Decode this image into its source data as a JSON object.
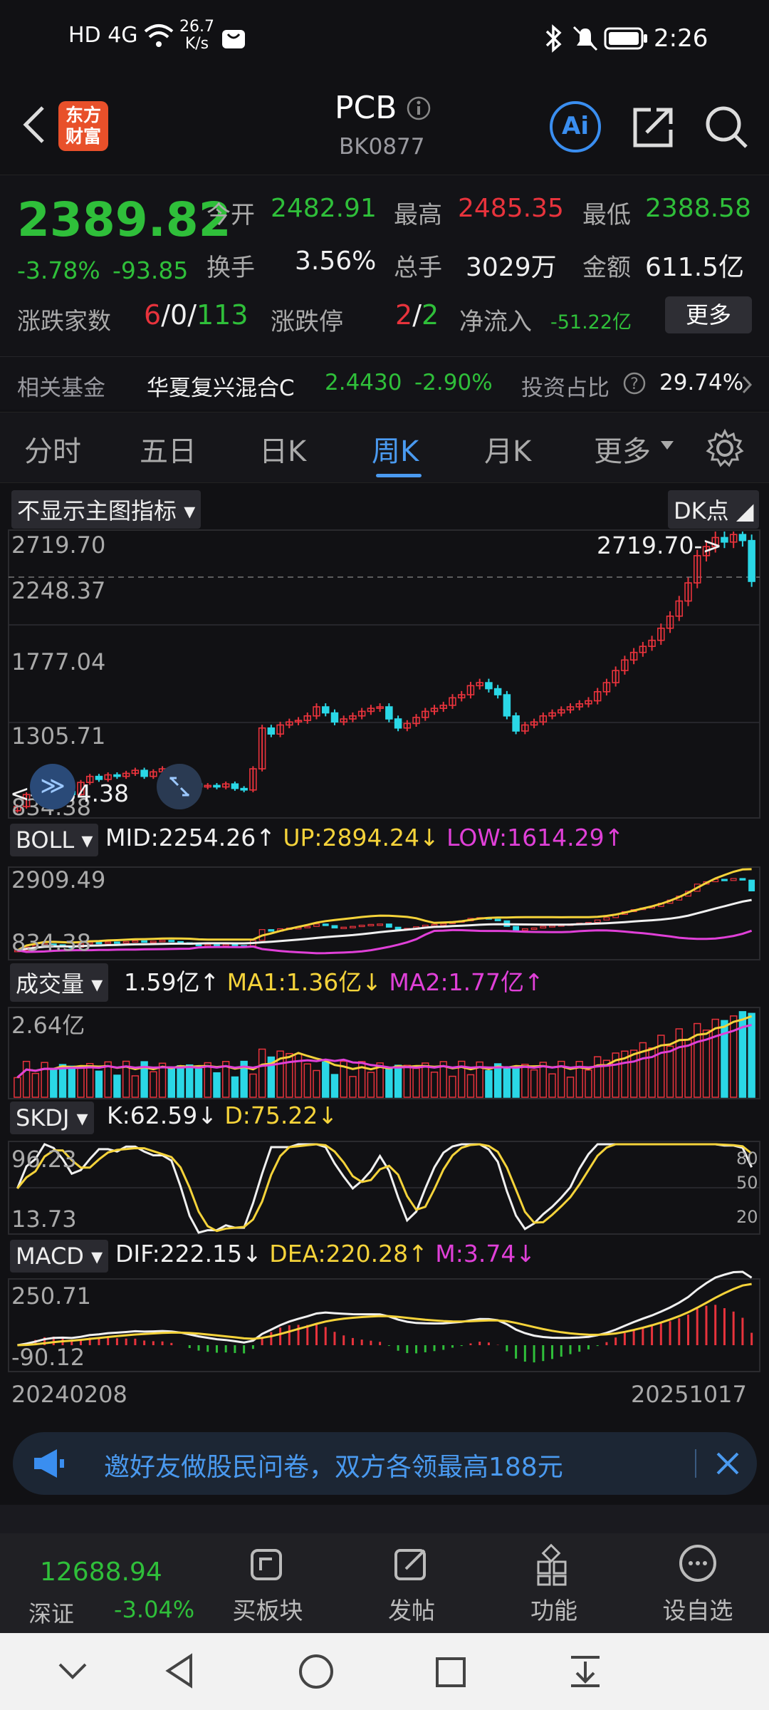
{
  "status_bar": {
    "left_icons": "HD 4G",
    "net_speed_value": "26.7",
    "net_speed_unit": "K/s",
    "time": "2:26"
  },
  "header": {
    "logo_line1": "东方",
    "logo_line2": "财富",
    "title": "PCB",
    "code": "BK0877",
    "ai_label": "Ai"
  },
  "quote": {
    "price": "2389.82",
    "change_pct": "-3.78%",
    "change_abs": "-93.85",
    "open_label": "今开",
    "open": "2482.91",
    "high_label": "最高",
    "high": "2485.35",
    "low_label": "最低",
    "low": "2388.58",
    "turnover_label": "换手",
    "turnover": "3.56%",
    "volume_label": "总手",
    "volume": "3029万",
    "amount_label": "金额",
    "amount": "611.5亿",
    "breadth_label": "涨跌家数",
    "breadth_up": "6",
    "breadth_sep1": "/",
    "breadth_flat": "0",
    "breadth_sep2": "/",
    "breadth_down": "113",
    "limit_label": "涨跌停",
    "limit_up": "2",
    "limit_sep": "/",
    "limit_down": "2",
    "netflow_label": "净流入",
    "netflow": "-51.22亿",
    "more_button": "更多"
  },
  "fund": {
    "label": "相关基金",
    "name": "华夏复兴混合C",
    "nav": "2.4430",
    "change": "-2.90%",
    "ratio_label": "投资占比",
    "ratio": "29.74%"
  },
  "tabs": [
    "分时",
    "五日",
    "日K",
    "周K",
    "月K",
    "更多"
  ],
  "active_tab": "周K",
  "chart": {
    "main_indicator_select": "不显示主图指标",
    "dk_button": "DK点",
    "main_axis": [
      "2719.70",
      "2248.37",
      "1777.04",
      "1305.71",
      "834.38"
    ],
    "max_marker": "2719.70->",
    "min_marker": "<--834.38",
    "boll": {
      "name": "BOLL",
      "mid": "MID:2254.26",
      "up": "UP:2894.24",
      "low": "LOW:1614.29",
      "axis_top": "2909.49",
      "axis_bottom": "834.38"
    },
    "volume": {
      "name": "成交量",
      "value": "1.59亿",
      "ma1": "MA1:1.36亿",
      "ma2": "MA2:1.77亿",
      "axis_top": "2.64亿"
    },
    "skdj": {
      "name": "SKDJ",
      "k": "K:62.59",
      "d": "D:75.22",
      "axis_top": "96.23",
      "axis_bottom": "13.73",
      "right_80": "80",
      "right_50": "50",
      "right_20": "20"
    },
    "macd": {
      "name": "MACD",
      "dif": "DIF:222.15",
      "dea": "DEA:220.28",
      "m": "M:3.74",
      "axis_top": "250.71",
      "axis_bottom": "-90.12"
    },
    "date_start": "20240208",
    "date_end": "20251017"
  },
  "chart_data": {
    "type": "candlestick",
    "title": "PCB 周K",
    "x_range": [
      "20240208",
      "20251017"
    ],
    "ylim": [
      834.38,
      2719.7
    ],
    "closes": [
      900,
      980,
      1020,
      1060,
      1040,
      1000,
      980,
      1060,
      1100,
      1080,
      1110,
      1100,
      1120,
      1140,
      1100,
      1130,
      1150,
      1120,
      1090,
      1050,
      1030,
      1040,
      1030,
      1050,
      1020,
      1010,
      1150,
      1420,
      1380,
      1440,
      1460,
      1470,
      1500,
      1560,
      1520,
      1460,
      1480,
      1500,
      1530,
      1550,
      1560,
      1480,
      1420,
      1450,
      1490,
      1530,
      1550,
      1570,
      1620,
      1640,
      1700,
      1720,
      1680,
      1640,
      1500,
      1400,
      1440,
      1460,
      1500,
      1520,
      1540,
      1560,
      1580,
      1600,
      1660,
      1720,
      1800,
      1870,
      1920,
      1960,
      2000,
      2080,
      2160,
      2260,
      2380,
      2560,
      2620,
      2680,
      2650,
      2700,
      2660,
      2389.82
    ],
    "up_color": "#e8333c",
    "down_color": "#2ad7e6"
  }
}
